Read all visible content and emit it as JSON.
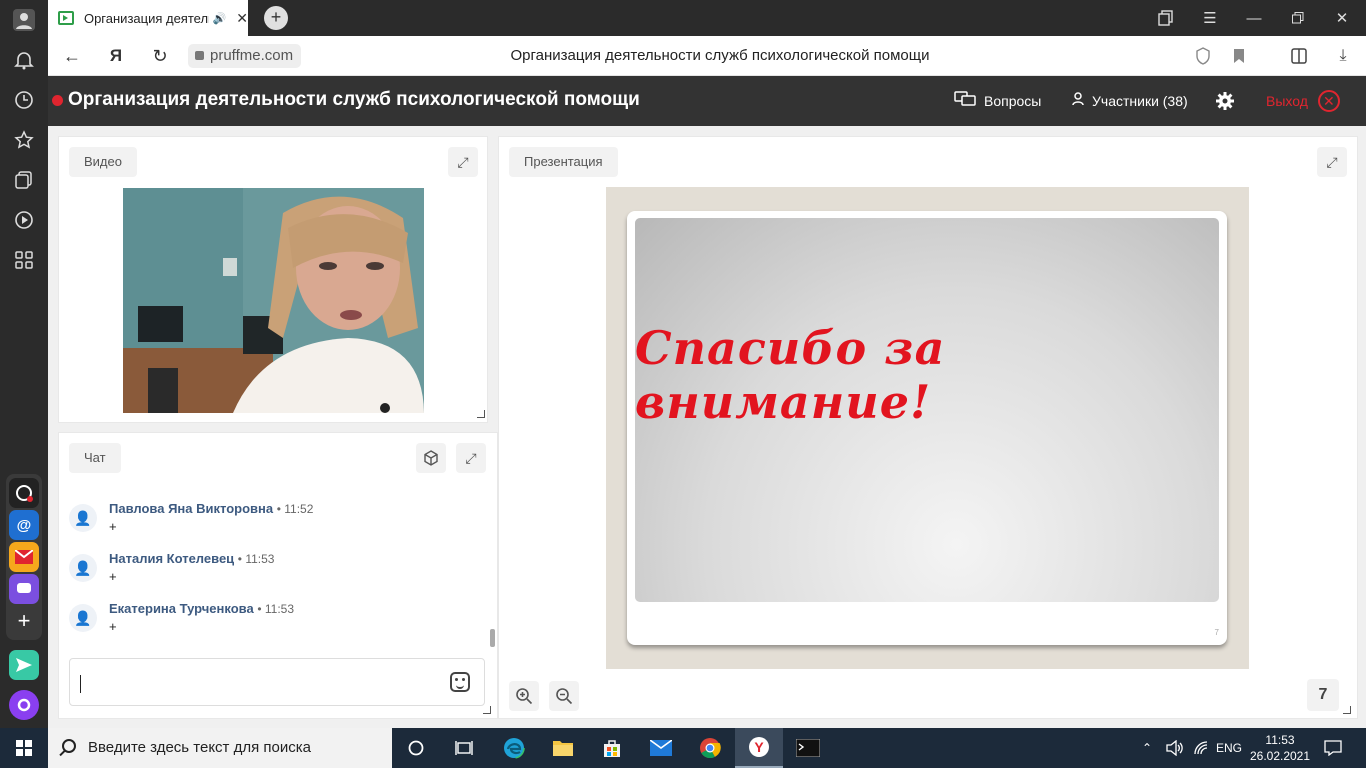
{
  "browser": {
    "tab_title": "Организация деятельности служб психологической помощи",
    "url": "pruffme.com",
    "page_title": "Организация деятельности служб психологической помощи",
    "new_tab_label": "+",
    "yandex_label": "Я"
  },
  "header": {
    "title": "Организация деятельности служб психологической помощи",
    "questions_label": "Вопросы",
    "participants_label": "Участники (38)",
    "exit_label": "Выход"
  },
  "video_panel": {
    "label": "Видео"
  },
  "chat_panel": {
    "label": "Чат",
    "messages": [
      {
        "author": "Павлова Яна Викторовна",
        "time": "• 11:52",
        "text": "+"
      },
      {
        "author": "Наталия Котелевец",
        "time": "• 11:53",
        "text": "+"
      },
      {
        "author": "Екатерина Турченкова",
        "time": "• 11:53",
        "text": "+"
      }
    ]
  },
  "presentation_panel": {
    "label": "Презентация",
    "slide_text": "Спасибо за внимание!",
    "slide_small_number": "7",
    "page_number": "7"
  },
  "taskbar": {
    "search_placeholder": "Введите здесь текст для поиска",
    "language": "ENG",
    "time": "11:53",
    "date": "26.02.2021"
  },
  "colors": {
    "accent_red": "#e0252f",
    "header_bg": "#333333",
    "chat_author": "#3d5a80",
    "slide_text": "#e2141f"
  }
}
